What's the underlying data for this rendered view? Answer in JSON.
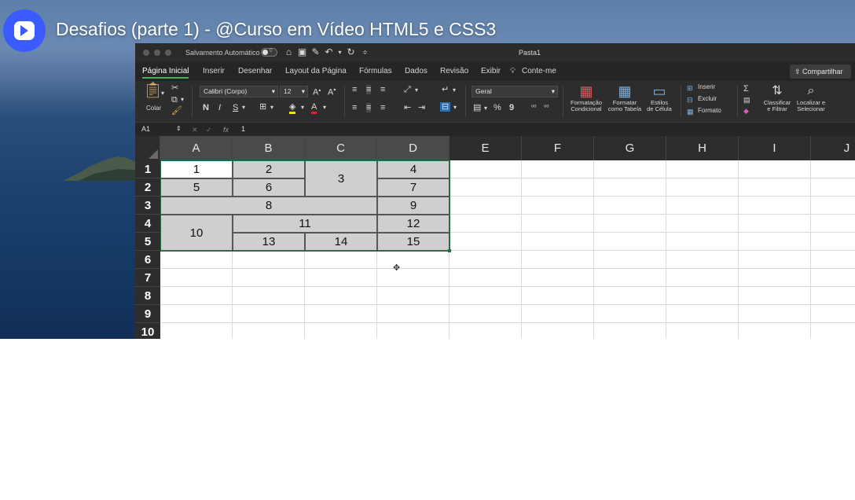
{
  "video": {
    "title": "Desafios (parte 1) - @Curso em Vídeo HTML5 e CSS3",
    "logo_icon": "play-logo-icon"
  },
  "excel": {
    "window": {
      "autosave_label": "Salvamento Automático",
      "autosave_state": "0",
      "document_title": "Pasta1"
    },
    "tabs": [
      "Página Inicial",
      "Inserir",
      "Desenhar",
      "Layout da Página",
      "Fórmulas",
      "Dados",
      "Revisão",
      "Exibir",
      "Conte-me"
    ],
    "active_tab": "Página Inicial",
    "share_label": "Compartilhar",
    "ribbon": {
      "paste_label": "Colar",
      "font_name": "Calibri (Corpo)",
      "font_size": "12",
      "bold": "N",
      "italic": "I",
      "underline": "S",
      "number_format": "Geral",
      "conditional_format": [
        "Formatação",
        "Condicional"
      ],
      "format_table": [
        "Formatar",
        "como Tabela"
      ],
      "cell_styles": [
        "Estilos",
        "de Célula"
      ],
      "insert": "Inserir",
      "delete": "Excluir",
      "format": "Formato",
      "sort_filter": [
        "Classificar",
        "e Filtrar"
      ],
      "find_select": [
        "Localizar e",
        "Selecionar"
      ]
    },
    "formula_bar": {
      "name_box": "A1",
      "value": "1"
    },
    "columns": [
      "A",
      "B",
      "C",
      "D",
      "E",
      "F",
      "G",
      "H",
      "I",
      "J"
    ],
    "rows": [
      "1",
      "2",
      "3",
      "4",
      "5",
      "6",
      "7",
      "8",
      "9",
      "10"
    ],
    "cells": {
      "a1": "1",
      "b1": "2",
      "c1_2": "3",
      "d1": "4",
      "a2": "5",
      "b2": "6",
      "d2": "7",
      "a3_c3": "8",
      "d3": "9",
      "a4_5": "10",
      "b4_c4": "11",
      "d4": "12",
      "b5": "13",
      "c5": "14",
      "d5": "15"
    },
    "colors": {
      "accent_green": "#1e7145",
      "header_dark": "#2d2d2d",
      "cell_shade": "#cfcfcf"
    }
  }
}
